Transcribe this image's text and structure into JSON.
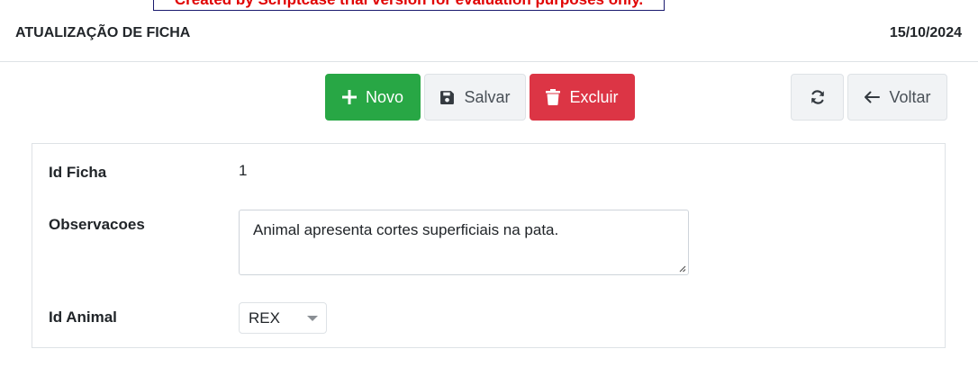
{
  "banner": {
    "text": "Created by Scriptcase trial version for evaluation purposes only."
  },
  "header": {
    "title": "ATUALIZAÇÃO DE FICHA",
    "date": "15/10/2024"
  },
  "toolbar": {
    "novo_label": "Novo",
    "salvar_label": "Salvar",
    "excluir_label": "Excluir",
    "voltar_label": "Voltar"
  },
  "icons": {
    "novo": "plus-icon",
    "salvar": "save-icon",
    "excluir": "trash-icon",
    "refresh": "refresh-icon",
    "voltar": "arrow-left-icon"
  },
  "colors": {
    "success": "#28a745",
    "danger": "#dc3545",
    "trial_text": "#e00000"
  },
  "form": {
    "id_ficha": {
      "label": "Id Ficha",
      "value": "1"
    },
    "observacoes": {
      "label": "Observacoes",
      "value": "Animal apresenta cortes superficiais na pata."
    },
    "id_animal": {
      "label": "Id Animal",
      "selected": "REX"
    }
  }
}
